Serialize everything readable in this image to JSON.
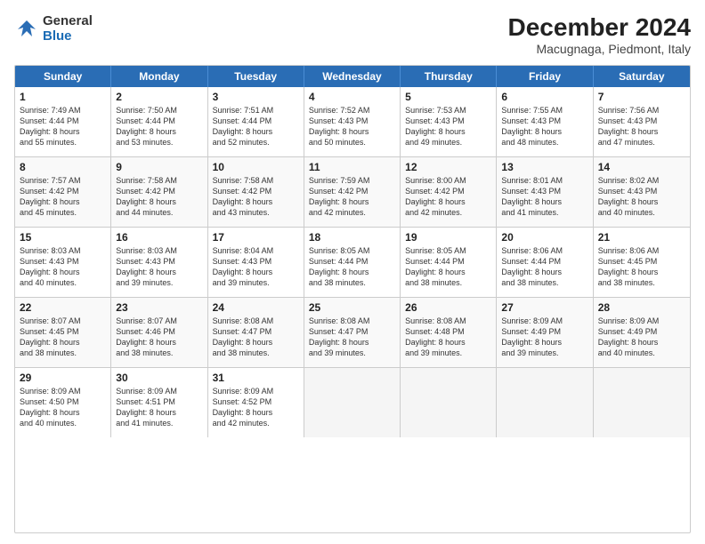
{
  "header": {
    "logo_line1": "General",
    "logo_line2": "Blue",
    "title": "December 2024",
    "subtitle": "Macugnaga, Piedmont, Italy"
  },
  "weekdays": [
    "Sunday",
    "Monday",
    "Tuesday",
    "Wednesday",
    "Thursday",
    "Friday",
    "Saturday"
  ],
  "weeks": [
    [
      {
        "day": "1",
        "sr": "7:49 AM",
        "ss": "4:44 PM",
        "dl": "8 hours and 55 minutes."
      },
      {
        "day": "2",
        "sr": "7:50 AM",
        "ss": "4:44 PM",
        "dl": "8 hours and 53 minutes."
      },
      {
        "day": "3",
        "sr": "7:51 AM",
        "ss": "4:44 PM",
        "dl": "8 hours and 52 minutes."
      },
      {
        "day": "4",
        "sr": "7:52 AM",
        "ss": "4:43 PM",
        "dl": "8 hours and 50 minutes."
      },
      {
        "day": "5",
        "sr": "7:53 AM",
        "ss": "4:43 PM",
        "dl": "8 hours and 49 minutes."
      },
      {
        "day": "6",
        "sr": "7:55 AM",
        "ss": "4:43 PM",
        "dl": "8 hours and 48 minutes."
      },
      {
        "day": "7",
        "sr": "7:56 AM",
        "ss": "4:43 PM",
        "dl": "8 hours and 47 minutes."
      }
    ],
    [
      {
        "day": "8",
        "sr": "7:57 AM",
        "ss": "4:42 PM",
        "dl": "8 hours and 45 minutes."
      },
      {
        "day": "9",
        "sr": "7:58 AM",
        "ss": "4:42 PM",
        "dl": "8 hours and 44 minutes."
      },
      {
        "day": "10",
        "sr": "7:58 AM",
        "ss": "4:42 PM",
        "dl": "8 hours and 43 minutes."
      },
      {
        "day": "11",
        "sr": "7:59 AM",
        "ss": "4:42 PM",
        "dl": "8 hours and 42 minutes."
      },
      {
        "day": "12",
        "sr": "8:00 AM",
        "ss": "4:42 PM",
        "dl": "8 hours and 42 minutes."
      },
      {
        "day": "13",
        "sr": "8:01 AM",
        "ss": "4:43 PM",
        "dl": "8 hours and 41 minutes."
      },
      {
        "day": "14",
        "sr": "8:02 AM",
        "ss": "4:43 PM",
        "dl": "8 hours and 40 minutes."
      }
    ],
    [
      {
        "day": "15",
        "sr": "8:03 AM",
        "ss": "4:43 PM",
        "dl": "8 hours and 40 minutes."
      },
      {
        "day": "16",
        "sr": "8:03 AM",
        "ss": "4:43 PM",
        "dl": "8 hours and 39 minutes."
      },
      {
        "day": "17",
        "sr": "8:04 AM",
        "ss": "4:43 PM",
        "dl": "8 hours and 39 minutes."
      },
      {
        "day": "18",
        "sr": "8:05 AM",
        "ss": "4:44 PM",
        "dl": "8 hours and 38 minutes."
      },
      {
        "day": "19",
        "sr": "8:05 AM",
        "ss": "4:44 PM",
        "dl": "8 hours and 38 minutes."
      },
      {
        "day": "20",
        "sr": "8:06 AM",
        "ss": "4:44 PM",
        "dl": "8 hours and 38 minutes."
      },
      {
        "day": "21",
        "sr": "8:06 AM",
        "ss": "4:45 PM",
        "dl": "8 hours and 38 minutes."
      }
    ],
    [
      {
        "day": "22",
        "sr": "8:07 AM",
        "ss": "4:45 PM",
        "dl": "8 hours and 38 minutes."
      },
      {
        "day": "23",
        "sr": "8:07 AM",
        "ss": "4:46 PM",
        "dl": "8 hours and 38 minutes."
      },
      {
        "day": "24",
        "sr": "8:08 AM",
        "ss": "4:47 PM",
        "dl": "8 hours and 38 minutes."
      },
      {
        "day": "25",
        "sr": "8:08 AM",
        "ss": "4:47 PM",
        "dl": "8 hours and 39 minutes."
      },
      {
        "day": "26",
        "sr": "8:08 AM",
        "ss": "4:48 PM",
        "dl": "8 hours and 39 minutes."
      },
      {
        "day": "27",
        "sr": "8:09 AM",
        "ss": "4:49 PM",
        "dl": "8 hours and 39 minutes."
      },
      {
        "day": "28",
        "sr": "8:09 AM",
        "ss": "4:49 PM",
        "dl": "8 hours and 40 minutes."
      }
    ],
    [
      {
        "day": "29",
        "sr": "8:09 AM",
        "ss": "4:50 PM",
        "dl": "8 hours and 40 minutes."
      },
      {
        "day": "30",
        "sr": "8:09 AM",
        "ss": "4:51 PM",
        "dl": "8 hours and 41 minutes."
      },
      {
        "day": "31",
        "sr": "8:09 AM",
        "ss": "4:52 PM",
        "dl": "8 hours and 42 minutes."
      },
      null,
      null,
      null,
      null
    ]
  ]
}
